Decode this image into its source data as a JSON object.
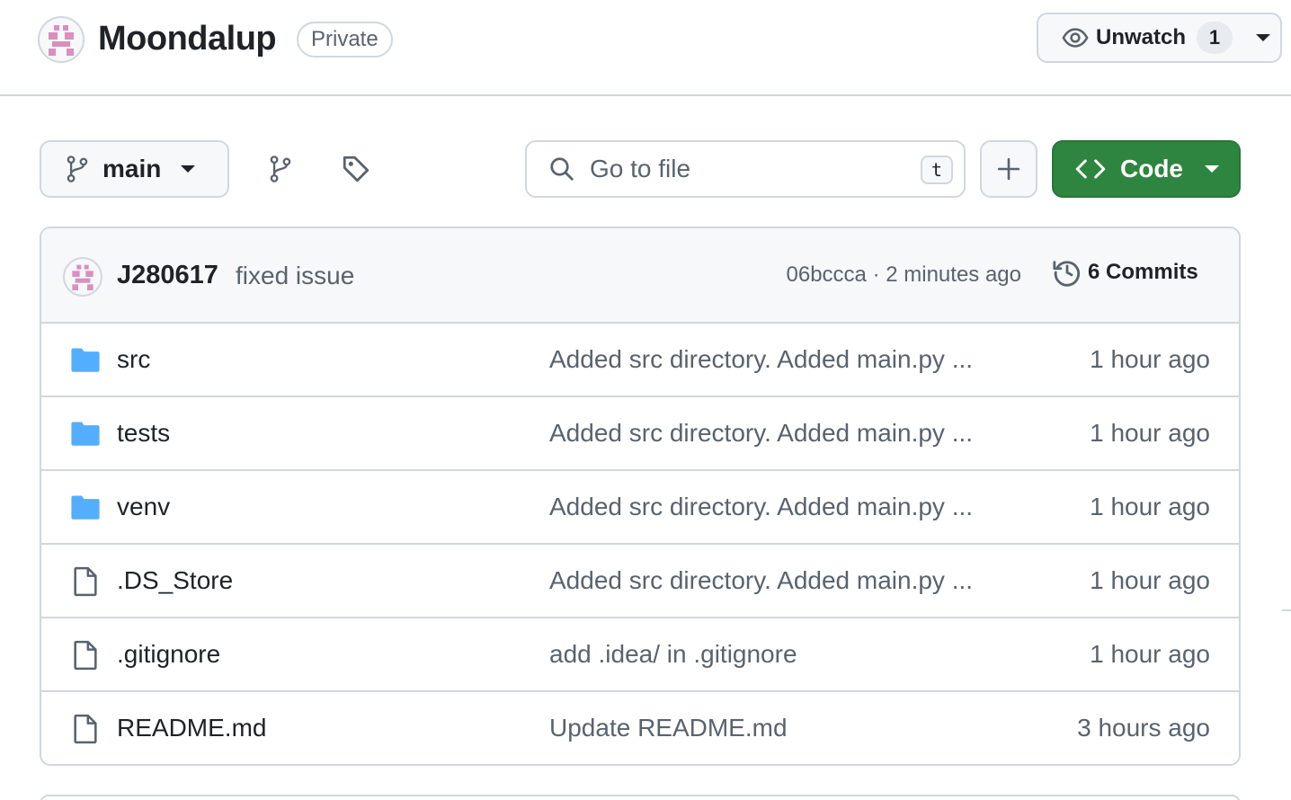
{
  "repo": {
    "name": "Moondalup",
    "visibility": "Private",
    "watch_label": "Unwatch",
    "watch_count": "1"
  },
  "toolbar": {
    "branch": "main",
    "search_placeholder": "Go to file",
    "search_shortcut": "t",
    "code_label": "Code"
  },
  "latest_commit": {
    "author": "J280617",
    "message": "fixed issue",
    "meta": "06bccca · 2 minutes ago",
    "commits_label": "6 Commits"
  },
  "files": [
    {
      "name": "src",
      "type": "folder",
      "commit": "Added src directory. Added main.py ...",
      "age": "1 hour ago"
    },
    {
      "name": "tests",
      "type": "folder",
      "commit": "Added src directory. Added main.py ...",
      "age": "1 hour ago"
    },
    {
      "name": "venv",
      "type": "folder",
      "commit": "Added src directory. Added main.py ...",
      "age": "1 hour ago"
    },
    {
      "name": ".DS_Store",
      "type": "file",
      "commit": "Added src directory. Added main.py ...",
      "age": "1 hour ago"
    },
    {
      "name": ".gitignore",
      "type": "file",
      "commit": "add .idea/ in .gitignore",
      "age": "1 hour ago"
    },
    {
      "name": "README.md",
      "type": "file",
      "commit": "Update README.md",
      "age": "3 hours ago"
    }
  ],
  "colors": {
    "accent_green": "#2e8540",
    "folder_blue": "#54aeff",
    "border": "#d0d7de",
    "muted_text": "#59636e",
    "avatar_pink": "#d98fc0"
  },
  "icons": {
    "watch": "eye-icon",
    "branch": "git-branch-icon",
    "tag": "tag-icon",
    "search": "search-icon",
    "add": "plus-icon",
    "code": "code-icon",
    "history": "history-icon",
    "folder": "folder-icon",
    "file": "file-icon"
  }
}
